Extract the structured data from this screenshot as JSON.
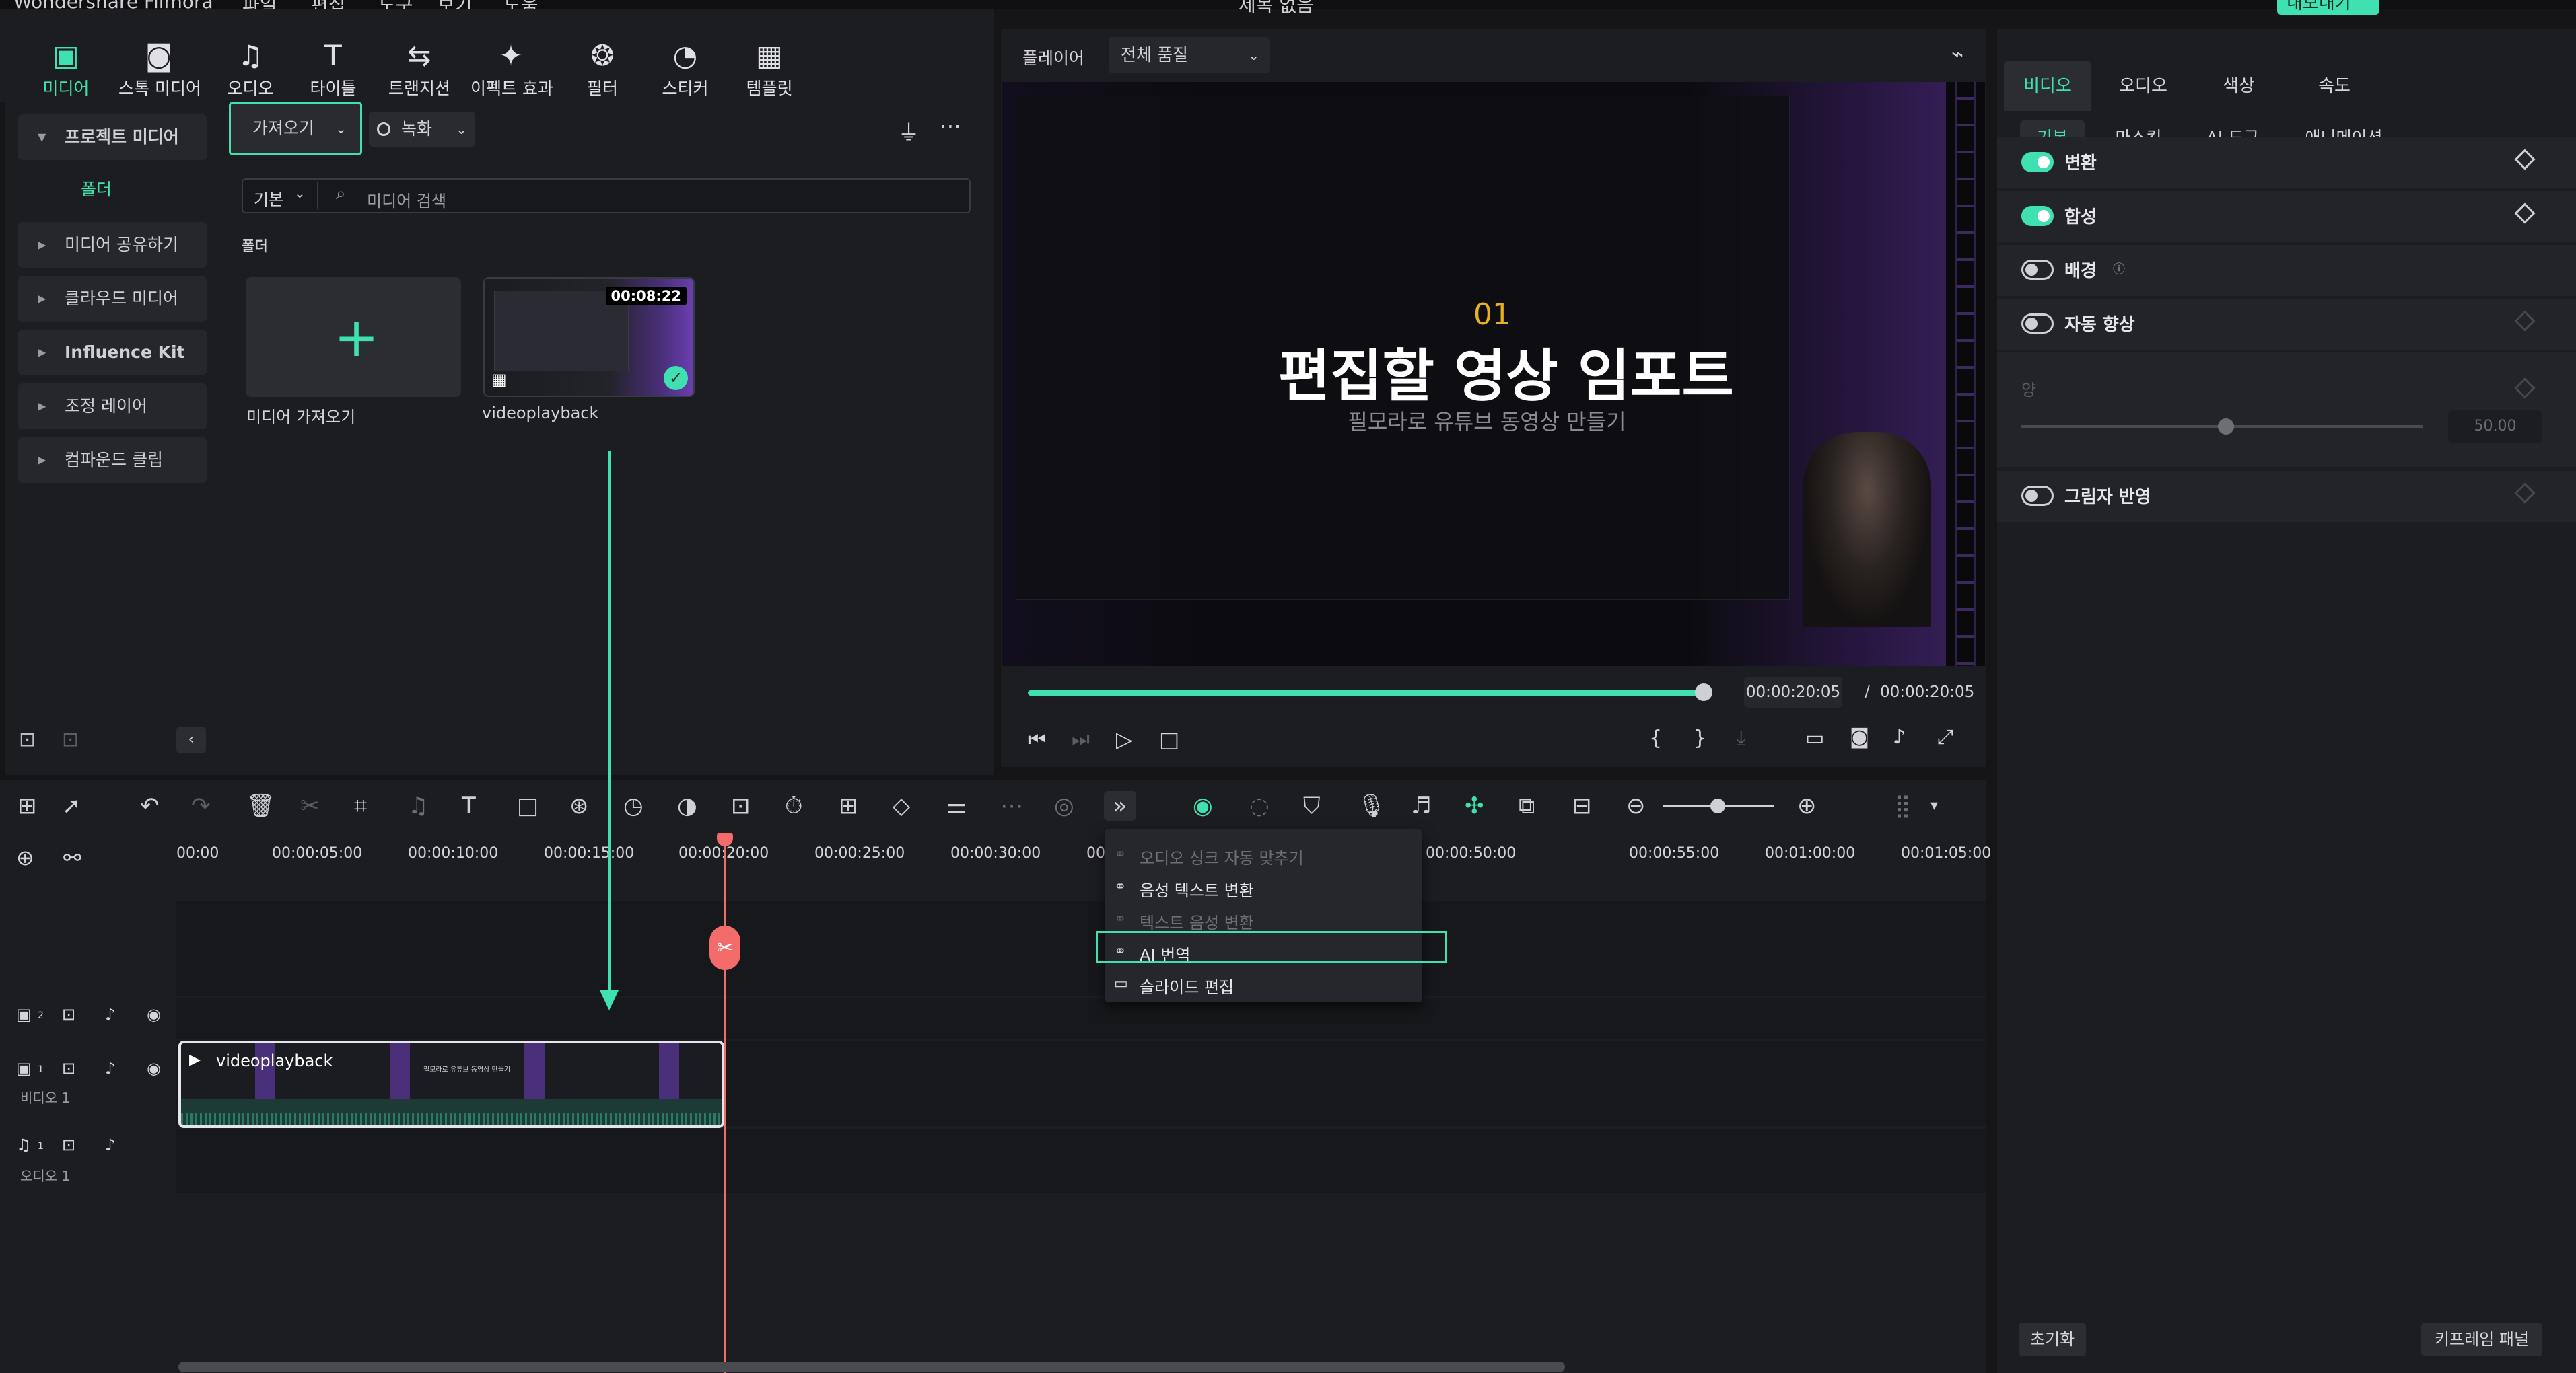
{
  "window": {
    "app": "Wondershare Filmora",
    "menus": [
      "파일",
      "편집",
      "도구",
      "보기",
      "도움"
    ],
    "project_title": "제목 없음",
    "export_label": "내보내기"
  },
  "toolbar": [
    {
      "label": "미디어",
      "icon": "media-icon"
    },
    {
      "label": "스톡 미디어",
      "icon": "stock-media-icon"
    },
    {
      "label": "오디오",
      "icon": "audio-icon"
    },
    {
      "label": "타이틀",
      "icon": "title-icon"
    },
    {
      "label": "트랜지션",
      "icon": "transition-icon"
    },
    {
      "label": "이펙트 효과",
      "icon": "effects-icon"
    },
    {
      "label": "필터",
      "icon": "filter-icon"
    },
    {
      "label": "스티커",
      "icon": "sticker-icon"
    },
    {
      "label": "템플릿",
      "icon": "template-icon"
    }
  ],
  "sidebar": {
    "project_media": "프로젝트 미디어",
    "folder": "폴더",
    "items": [
      "미디어 공유하기",
      "클라우드 미디어",
      "Influence Kit",
      "조정 레이어",
      "컴파운드 클립"
    ]
  },
  "media": {
    "import_label": "가져오기",
    "record_label": "녹화",
    "sort_label": "기본",
    "search_placeholder": "미디어 검색",
    "section_label": "폴더",
    "import_card_label": "미디어 가져오기",
    "clip_name": "videoplayback",
    "clip_duration": "00:08:22"
  },
  "player": {
    "label": "플레이어",
    "quality": "전체 품질",
    "video_number": "01",
    "video_title": "편집할 영상 임포트",
    "video_subtitle": "필모라로 유튜브 동영상 만들기",
    "current_time": "00:00:20:05",
    "separator": "/",
    "total_time": "00:00:20:05",
    "progress": 1.0
  },
  "inspector": {
    "tabs": [
      "비디오",
      "오디오",
      "색상",
      "속도"
    ],
    "subtabs": [
      "기본",
      "마스킹",
      "AI 도구",
      "애니메이션"
    ],
    "props": [
      {
        "label": "변환",
        "on": true
      },
      {
        "label": "합성",
        "on": true
      },
      {
        "label": "배경",
        "on": false
      },
      {
        "label": "자동 향상",
        "on": false
      }
    ],
    "amount_label": "양",
    "amount_value": "50.00",
    "shadow_label": "그림자 반영",
    "reset_label": "초기화",
    "keyframe_label": "키프레임 패널"
  },
  "timeline": {
    "ticks": [
      "00:00",
      "00:00:05:00",
      "00:00:10:00",
      "00:00:15:00",
      "00:00:20:00",
      "00:00:25:00",
      "00:00:30:00",
      "00",
      "00:00:50:00",
      "00:00:55:00",
      "00:01:00:00",
      "00:01:05:00"
    ],
    "tracks": {
      "v2": "2",
      "v1": "1",
      "v1_label": "비디오 1",
      "a1": "1",
      "a1_label": "오디오 1"
    },
    "clip_label": "videoplayback",
    "clip_inner_text": "필모라로 유튜브 동영상 만들기"
  },
  "context_menu": [
    {
      "label": "오디오 싱크 자동 맞추기",
      "disabled": true
    },
    {
      "label": "음성 텍스트 변환",
      "disabled": false
    },
    {
      "label": "텍스트 음성 변환",
      "disabled": true
    },
    {
      "label": "AI 번역",
      "disabled": false,
      "highlighted": true
    },
    {
      "label": "슬라이드 편집",
      "disabled": false
    }
  ],
  "colors": {
    "accent": "#3fe0b2",
    "playhead": "#f36b6b"
  }
}
